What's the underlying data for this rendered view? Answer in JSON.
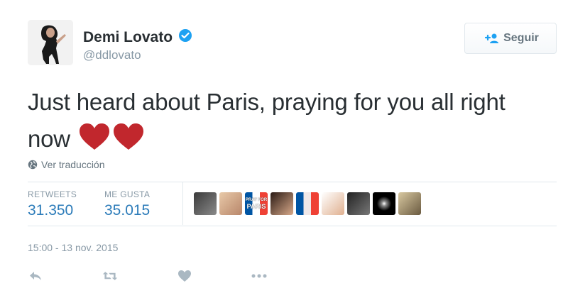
{
  "user": {
    "full_name": "Demi Lovato",
    "screen_name": "@ddlovato",
    "verified": true
  },
  "follow_button": {
    "label": "Seguir"
  },
  "tweet": {
    "text": "Just heard about Paris, praying for you all right now",
    "emoji": [
      "red-heart",
      "red-heart"
    ]
  },
  "translate_link": "Ver traducción",
  "stats": {
    "retweets_label": "RETWEETS",
    "retweets_value": "31.350",
    "likes_label": "ME GUSTA",
    "likes_value": "35.015"
  },
  "liker_avatars": {
    "count": 9,
    "pray_for_paris_text": [
      "PRAY FOR",
      "PARIS"
    ]
  },
  "timestamp": "15:00 - 13 nov. 2015",
  "actions": [
    "reply-icon",
    "retweet-icon",
    "like-icon",
    "more-icon"
  ],
  "colors": {
    "link_blue": "#2b7bb9",
    "verified_blue": "#1da1f2",
    "muted": "#8899a6",
    "heart_red": "#c1272d"
  }
}
